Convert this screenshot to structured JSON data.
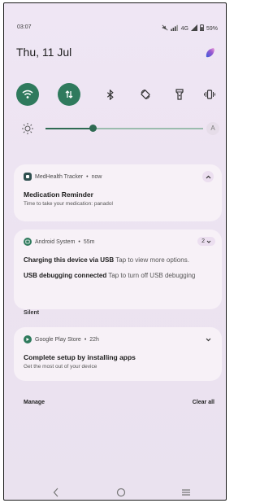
{
  "status_bar": {
    "time": "03:07",
    "network_label": "4G",
    "battery": "59%"
  },
  "shade": {
    "date": "Thu, 11 Jul"
  },
  "quick_settings": [
    {
      "name": "wifi",
      "state": "on",
      "icon": "wifi-icon"
    },
    {
      "name": "mobile-data",
      "state": "on",
      "icon": "data-arrows-icon"
    },
    {
      "name": "bluetooth",
      "state": "off",
      "icon": "bluetooth-icon"
    },
    {
      "name": "auto-rotate",
      "state": "off",
      "icon": "rotate-icon"
    },
    {
      "name": "flashlight",
      "state": "off",
      "icon": "flashlight-icon"
    },
    {
      "name": "vibrate",
      "state": "off",
      "icon": "vibrate-icon"
    }
  ],
  "brightness": {
    "level": 0.27,
    "auto_label": "A"
  },
  "notifications": [
    {
      "app": "MedHealth Tracker",
      "time": "now",
      "title": "Medication Reminder",
      "text": "Time to take your medication: panadol"
    },
    {
      "app": "Android System",
      "time": "55m",
      "count": "2",
      "lines": [
        {
          "bold": "Charging this device via USB",
          "rest": " Tap to view more options."
        },
        {
          "bold": "USB debugging connected",
          "rest": " Tap to turn off USB debugging"
        }
      ]
    }
  ],
  "silent_section": {
    "header": "Silent",
    "notification": {
      "app": "Google Play Store",
      "time": "22h",
      "title": "Complete setup by installing apps",
      "text": "Get the most out of your device"
    }
  },
  "footer": {
    "manage": "Manage",
    "clear_all": "Clear all"
  },
  "colors": {
    "accent_on": "#2f7a5d",
    "background": "#ece3f1",
    "card": "#f7f1f7"
  }
}
